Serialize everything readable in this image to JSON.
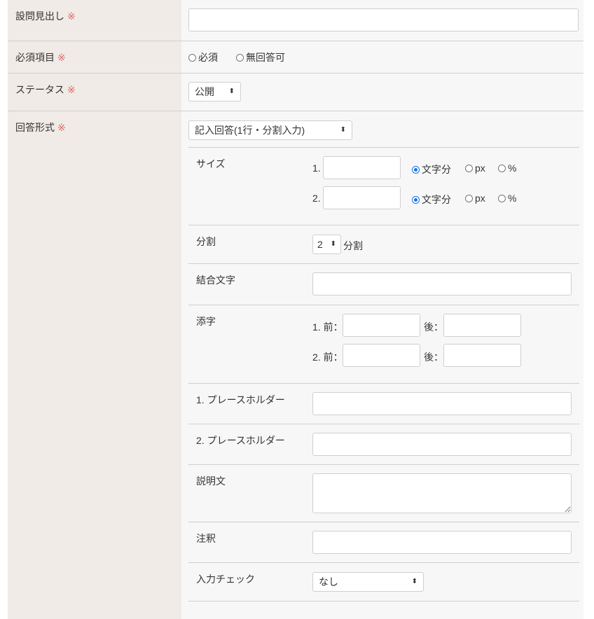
{
  "required_mark": "※",
  "question_heading": {
    "label": "設問見出し",
    "value": ""
  },
  "required_item": {
    "label": "必須項目",
    "options": [
      "必須",
      "無回答可"
    ],
    "selected": null
  },
  "status": {
    "label": "ステータス",
    "selected": "公開"
  },
  "answer_format": {
    "label": "回答形式",
    "selected": "記入回答(1行・分割入力)",
    "size": {
      "label": "サイズ",
      "rows": [
        {
          "num": "1.",
          "value": "",
          "units": [
            "文字分",
            "px",
            "%"
          ],
          "selected_unit": "文字分"
        },
        {
          "num": "2.",
          "value": "",
          "units": [
            "文字分",
            "px",
            "%"
          ],
          "selected_unit": "文字分"
        }
      ]
    },
    "split": {
      "label": "分割",
      "value": "2",
      "suffix": "分割"
    },
    "join_char": {
      "label": "結合文字",
      "value": ""
    },
    "affix": {
      "label": "添字",
      "rows": [
        {
          "pre_label": "1. 前：",
          "post_label": "後：",
          "pre": "",
          "post": ""
        },
        {
          "pre_label": "2. 前：",
          "post_label": "後：",
          "pre": "",
          "post": ""
        }
      ]
    },
    "placeholder1": {
      "label": "1. プレースホルダー",
      "value": ""
    },
    "placeholder2": {
      "label": "2. プレースホルダー",
      "value": ""
    },
    "description": {
      "label": "説明文",
      "value": ""
    },
    "note": {
      "label": "注釈",
      "value": ""
    },
    "input_check": {
      "label": "入力チェック",
      "selected": "なし"
    }
  },
  "colors": {
    "label_bg": "#f0ebe6",
    "value_bg": "#f7f7f7",
    "required": "#e06b6b",
    "radio_on": "#1a73e8"
  }
}
